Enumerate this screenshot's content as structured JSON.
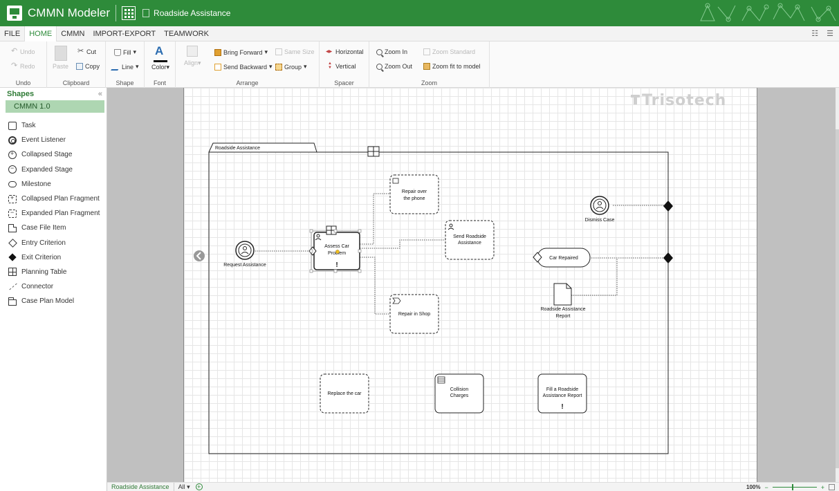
{
  "titlebar": {
    "app_name": "CMMN Modeler",
    "document": "Roadside Assistance"
  },
  "menu": [
    "FILE",
    "HOME",
    "CMMN",
    "IMPORT-EXPORT",
    "TEAMWORK"
  ],
  "menu_active": "HOME",
  "ribbon": {
    "undo": "Undo",
    "redo": "Redo",
    "paste": "Paste",
    "cut": "Cut",
    "copy": "Copy",
    "fill": "Fill",
    "line": "Line",
    "color": "Color",
    "align": "Align",
    "bring_forward": "Bring Forward",
    "send_backward": "Send Backward",
    "same_size": "Same Size",
    "group": "Group",
    "horizontal": "Horizontal",
    "vertical": "Vertical",
    "zoom_in": "Zoom In",
    "zoom_out": "Zoom Out",
    "zoom_standard": "Zoom Standard",
    "zoom_fit": "Zoom fit to model",
    "groups": {
      "undo": "Undo",
      "clipboard": "Clipboard",
      "shape": "Shape",
      "font": "Font",
      "arrange": "Arrange",
      "spacer": "Spacer",
      "zoom": "Zoom"
    }
  },
  "shapes_panel": {
    "title": "Shapes",
    "collapse": "«",
    "category": "CMMN 1.0",
    "items": [
      "Task",
      "Event Listener",
      "Collapsed Stage",
      "Expanded Stage",
      "Milestone",
      "Collapsed Plan Fragment",
      "Expanded Plan Fragment",
      "Case File Item",
      "Entry Criterion",
      "Exit Criterion",
      "Planning Table",
      "Connector",
      "Case Plan Model"
    ]
  },
  "diagram": {
    "brand": "Trisotech",
    "case_plan": "Roadside Assistance",
    "request_assistance": "Request Assistance",
    "assess_line1": "Assess Car",
    "assess_line2": "Problem",
    "repair_phone_line1": "Repair over",
    "repair_phone_line2": "the phone",
    "send_line1": "Send Roadside",
    "send_line2": "Assistance",
    "repair_shop": "Repair in Shop",
    "dismiss_case": "Dismiss Case",
    "car_repaired": "Car Repaired",
    "report_line1": "Roadside Assistance",
    "report_line2": "Report",
    "replace_car": "Replace the car",
    "collision_line1": "Collision",
    "collision_line2": "Charges",
    "fill_line1": "Fill a Roadside",
    "fill_line2": "Assistance Report",
    "required_mark": "!"
  },
  "bottombar": {
    "sheet": "Roadside Assistance",
    "all": "All",
    "add": "+",
    "zoom": "100%",
    "zoom_minus": "−",
    "zoom_plus": "+"
  }
}
